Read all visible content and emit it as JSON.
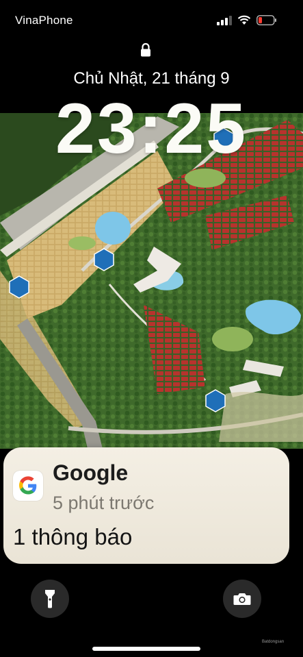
{
  "status_bar": {
    "carrier": "VinaPhone",
    "icons": [
      "cellular-signal-icon",
      "wifi-icon",
      "battery-low-icon"
    ],
    "battery_color": "#ff3b30"
  },
  "lock_screen": {
    "lock_icon": "lock-icon",
    "date": "Chủ Nhật, 21 tháng 9",
    "time": "23:25"
  },
  "notification": {
    "app_name": "Google",
    "time_ago": "5 phút trước",
    "message": "1 thông báo"
  },
  "bottom_controls": {
    "left": "flashlight-icon",
    "right": "camera-icon"
  },
  "watermark": "Batdongsan"
}
